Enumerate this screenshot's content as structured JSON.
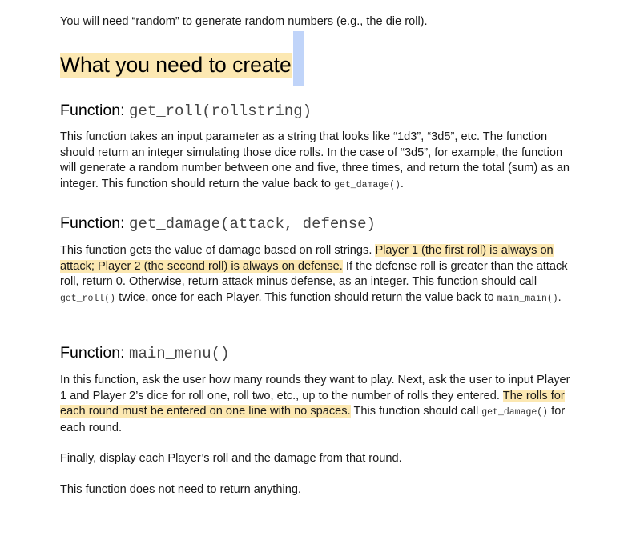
{
  "intro": {
    "text": "You will need “random” to generate random numbers (e.g., the die roll)."
  },
  "heading": {
    "title": "What you need to create"
  },
  "colors": {
    "highlight": "#fce8b2",
    "selection_cursor": "#c0d4f9"
  },
  "sections": [
    {
      "label": "Function: ",
      "signature": "get_roll(rollstring)",
      "paragraph": {
        "part1": "This function takes an input parameter as a string that looks like “1d3”, “3d5”, etc. The function should return an integer simulating those dice rolls. In the case of “3d5”, for example, the function will generate a random number between one and five, three times, and return the total (sum) as an integer. This function should return the value back to ",
        "code1": "get_damage()",
        "part2": "."
      }
    },
    {
      "label": "Function: ",
      "signature": "get_damage(attack, defense)",
      "paragraph": {
        "part1": "This function gets the value of damage based on roll strings. ",
        "highlight": "Player 1 (the first roll) is always on attack; Player 2 (the second roll) is always on defense.",
        "part2": " If the defense roll is greater than the attack roll, return 0. Otherwise, return attack minus defense, as an integer. This function should call ",
        "code1": "get_roll()",
        "part3": " twice, once for each Player. This function should return the value back to ",
        "code2": "main_main()",
        "part4": "."
      }
    },
    {
      "label": "Function: ",
      "signature": "main_menu()",
      "paragraph": {
        "part1": "In this function, ask the user how many rounds they want to play. Next, ask the user to input Player 1 and Player 2’s dice for roll one, roll two, etc., up to the number of rolls they entered. ",
        "highlight": "The rolls for each round must be entered on one line with no spaces.",
        "part2": " This function should call ",
        "code1": "get_damage()",
        "part3": " for each round."
      },
      "extra_paragraphs": [
        "Finally, display each Player’s roll and the damage from that round.",
        "This function does not need to return anything."
      ]
    }
  ]
}
